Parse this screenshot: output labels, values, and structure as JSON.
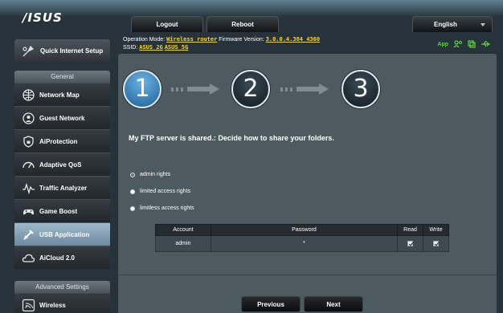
{
  "header": {
    "logo": "/ISUS",
    "logout": "Logout",
    "reboot": "Reboot",
    "language": "English"
  },
  "info": {
    "operation_mode_label": "Operation Mode:",
    "operation_mode_value": "Wireless router",
    "firmware_label": "Firmware Version:",
    "firmware_value": "3.0.0.4.384_4360",
    "ssid_label": "SSID:",
    "ssid_2g": "ASUS_2G",
    "ssid_5g": "ASUS_5G",
    "app_label": "App"
  },
  "sidebar": {
    "quick_setup": "Quick Internet Setup",
    "general_header": "General",
    "general_items": [
      {
        "label": "Network Map",
        "icon": "network-map-icon"
      },
      {
        "label": "Guest Network",
        "icon": "guest-network-icon"
      },
      {
        "label": "AiProtection",
        "icon": "aiprotection-icon"
      },
      {
        "label": "Adaptive QoS",
        "icon": "adaptive-qos-icon"
      },
      {
        "label": "Traffic Analyzer",
        "icon": "traffic-analyzer-icon"
      },
      {
        "label": "Game Boost",
        "icon": "game-boost-icon"
      },
      {
        "label": "USB Application",
        "icon": "usb-application-icon",
        "active": true
      },
      {
        "label": "AiCloud 2.0",
        "icon": "aicloud-icon"
      }
    ],
    "advanced_header": "Advanced Settings",
    "advanced_items": [
      {
        "label": "Wireless",
        "icon": "wireless-icon"
      }
    ]
  },
  "wizard": {
    "steps": [
      "1",
      "2",
      "3"
    ],
    "active_step": 1,
    "instruction": "My FTP server is shared.: Decide how to share your folders.",
    "options": [
      "admin rights",
      "limited access rights",
      "limitless access rights"
    ],
    "selected_option": 0,
    "table": {
      "headers": [
        "Account",
        "Password",
        "Read",
        "Write"
      ],
      "rows": [
        {
          "account": "admin",
          "password": "*",
          "read": true,
          "write": true
        }
      ]
    },
    "previous": "Previous",
    "next": "Next"
  },
  "colors": {
    "accent_link": "#ffd800",
    "status_green": "#5fd63a",
    "active_step": "#2e7fc0",
    "active_sidebar": "#8aa5ba"
  }
}
